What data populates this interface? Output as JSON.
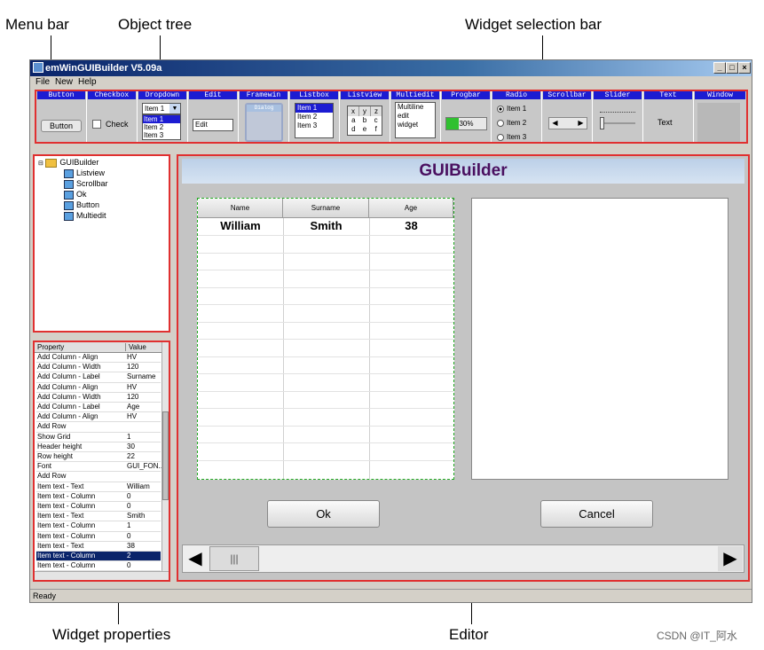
{
  "callouts": {
    "menu_bar": "Menu bar",
    "object_tree": "Object tree",
    "widget_selection_bar": "Widget selection bar",
    "widget_properties": "Widget properties",
    "editor": "Editor"
  },
  "watermark": "CSDN @IT_阿水",
  "window": {
    "title": "emWinGUIBuilder V5.09a",
    "min": "_",
    "max": "□",
    "close": "×"
  },
  "menu": [
    "File",
    "New",
    "Help"
  ],
  "toolbar": {
    "headers": [
      "Button",
      "Checkbox",
      "Dropdown",
      "Edit",
      "Framewin",
      "Listbox",
      "Listview",
      "Multiedit",
      "Progbar",
      "Radio",
      "Scrollbar",
      "Slider",
      "Text",
      "Window"
    ],
    "button_label": "Button",
    "checkbox_label": "Check",
    "dropdown_selected": "Item 1",
    "dropdown_items": [
      "Item 1",
      "Item 2",
      "Item 3"
    ],
    "edit_value": "Edit",
    "framewin_caption": "Dialog",
    "listbox_items": [
      "Item 1",
      "Item 2",
      "Item 3"
    ],
    "listview_header": [
      "x",
      "y",
      "z"
    ],
    "listview_row1": [
      "a",
      "b",
      "c"
    ],
    "listview_row2": [
      "d",
      "e",
      "f"
    ],
    "multiedit_lines": [
      "Multiline",
      "edit",
      "widget"
    ],
    "progbar_value": "30%",
    "progbar_fraction": 0.3,
    "radio_items": [
      "Item 1",
      "Item 2",
      "Item 3"
    ],
    "text_label": "Text"
  },
  "tree": {
    "root": "GUIBuilder",
    "children": [
      "Listview",
      "Scrollbar",
      "Ok",
      "Button",
      "Multiedit"
    ]
  },
  "properties": {
    "headers": [
      "Property",
      "Value"
    ],
    "rows": [
      [
        "Add Column - Align",
        "HV"
      ],
      [
        "Add Column - Width",
        "120"
      ],
      [
        "Add Column - Label",
        "Surname"
      ],
      [
        "Add Column - Align",
        "HV"
      ],
      [
        "Add Column - Width",
        "120"
      ],
      [
        "Add Column - Label",
        "Age"
      ],
      [
        "Add Column - Align",
        "HV"
      ],
      [
        "Add Row",
        ""
      ],
      [
        "Show Grid",
        "1"
      ],
      [
        "Header height",
        "30"
      ],
      [
        "Row height",
        "22"
      ],
      [
        "Font",
        "GUI_FON.."
      ],
      [
        "Add Row",
        ""
      ],
      [
        "Item text - Text",
        "William"
      ],
      [
        "Item text - Column",
        "0"
      ],
      [
        "Item text - Column",
        "0"
      ],
      [
        "Item text - Text",
        "Smith"
      ],
      [
        "Item text - Column",
        "1"
      ],
      [
        "Item text - Column",
        "0"
      ],
      [
        "Item text - Text",
        "38"
      ],
      [
        "Item text - Column",
        "2"
      ],
      [
        "Item text - Column",
        "0"
      ]
    ],
    "selected_row": 20
  },
  "editor": {
    "title": "GUIBuilder",
    "listview": {
      "columns": [
        "Name",
        "Surname",
        "Age"
      ],
      "row": [
        "William",
        "Smith",
        "38"
      ]
    },
    "ok_label": "Ok",
    "cancel_label": "Cancel"
  },
  "status": "Ready"
}
